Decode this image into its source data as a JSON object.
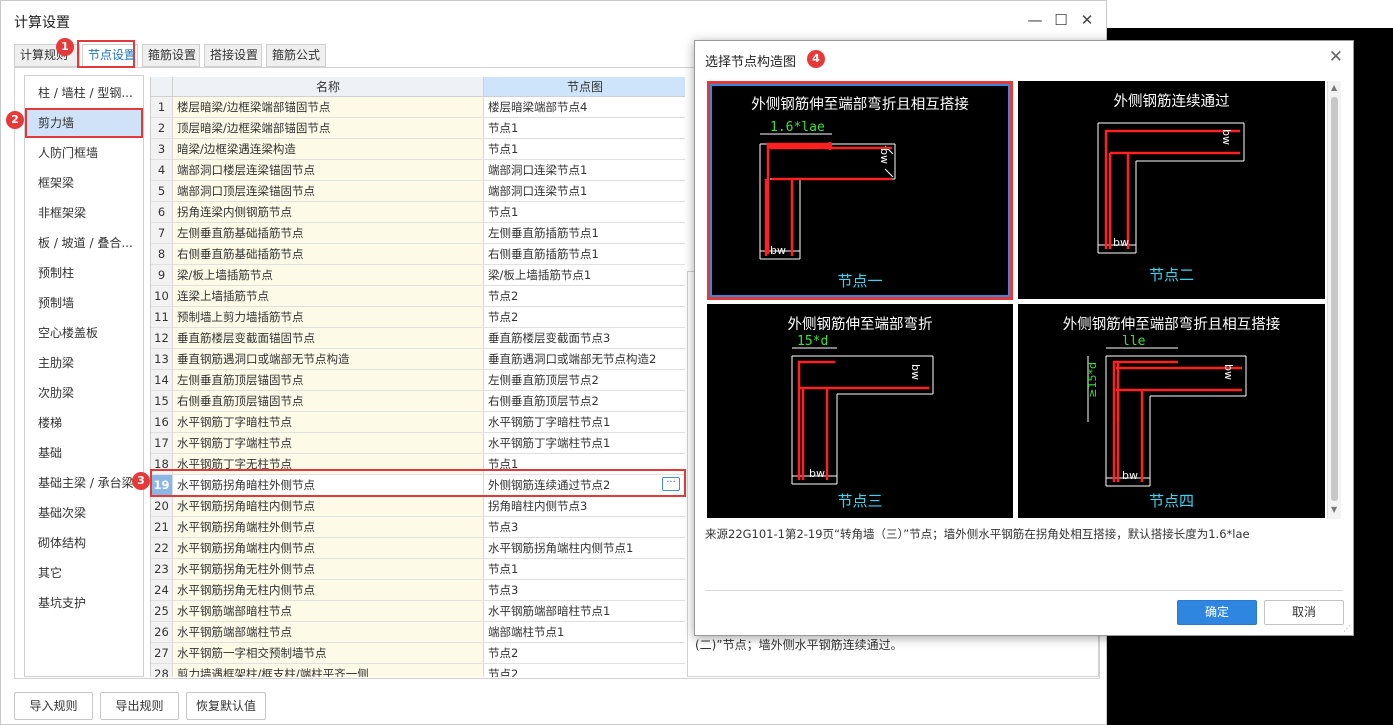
{
  "window": {
    "title": "计算设置",
    "minimize": "—",
    "maximize": "☐",
    "close": "✕"
  },
  "tabs": [
    {
      "label": "计算规则"
    },
    {
      "label": "节点设置"
    },
    {
      "label": "箍筋设置"
    },
    {
      "label": "搭接设置"
    },
    {
      "label": "箍筋公式"
    }
  ],
  "sidebar": {
    "items": [
      {
        "label": "柱 / 墙柱 / 型钢..."
      },
      {
        "label": "剪力墙"
      },
      {
        "label": "人防门框墙"
      },
      {
        "label": "框架梁"
      },
      {
        "label": "非框架梁"
      },
      {
        "label": "板 / 坡道 / 叠合..."
      },
      {
        "label": "预制柱"
      },
      {
        "label": "预制墙"
      },
      {
        "label": "空心楼盖板"
      },
      {
        "label": "主肋梁"
      },
      {
        "label": "次肋梁"
      },
      {
        "label": "楼梯"
      },
      {
        "label": "基础"
      },
      {
        "label": "基础主梁 / 承台梁"
      },
      {
        "label": "基础次梁"
      },
      {
        "label": "砌体结构"
      },
      {
        "label": "其它"
      },
      {
        "label": "基坑支护"
      }
    ]
  },
  "grid": {
    "columns": {
      "name": "名称",
      "node": "节点图"
    },
    "rows": [
      {
        "idx": "1",
        "name": "楼层暗梁/边框梁端部锚固节点",
        "node": "楼层暗梁端部节点4"
      },
      {
        "idx": "2",
        "name": "顶层暗梁/边框梁端部锚固节点",
        "node": "节点1"
      },
      {
        "idx": "3",
        "name": "暗梁/边框梁遇连梁构造",
        "node": "节点1"
      },
      {
        "idx": "4",
        "name": "端部洞口楼层连梁锚固节点",
        "node": "端部洞口连梁节点1"
      },
      {
        "idx": "5",
        "name": "端部洞口顶层连梁锚固节点",
        "node": "端部洞口连梁节点1"
      },
      {
        "idx": "6",
        "name": "拐角连梁内侧钢筋节点",
        "node": "节点1"
      },
      {
        "idx": "7",
        "name": "左侧垂直筋基础插筋节点",
        "node": "左侧垂直筋插筋节点1"
      },
      {
        "idx": "8",
        "name": "右侧垂直筋基础插筋节点",
        "node": "右侧垂直筋插筋节点1"
      },
      {
        "idx": "9",
        "name": "梁/板上墙插筋节点",
        "node": "梁/板上墙插筋节点1"
      },
      {
        "idx": "10",
        "name": "连梁上墙插筋节点",
        "node": "节点2"
      },
      {
        "idx": "11",
        "name": "预制墙上剪力墙插筋节点",
        "node": "节点2"
      },
      {
        "idx": "12",
        "name": "垂直筋楼层变截面锚固节点",
        "node": "垂直筋楼层变截面节点3"
      },
      {
        "idx": "13",
        "name": "垂直钢筋遇洞口或端部无节点构造",
        "node": "垂直筋遇洞口或端部无节点构造2"
      },
      {
        "idx": "14",
        "name": "左侧垂直筋顶层锚固节点",
        "node": "左侧垂直筋顶层节点2"
      },
      {
        "idx": "15",
        "name": "右侧垂直筋顶层锚固节点",
        "node": "右侧垂直筋顶层节点2"
      },
      {
        "idx": "16",
        "name": "水平钢筋丁字暗柱节点",
        "node": "水平钢筋丁字暗柱节点1"
      },
      {
        "idx": "17",
        "name": "水平钢筋丁字端柱节点",
        "node": "水平钢筋丁字端柱节点1"
      },
      {
        "idx": "18",
        "name": "水平钢筋丁字无柱节点",
        "node": "节点1"
      },
      {
        "idx": "19",
        "name": "水平钢筋拐角暗柱外侧节点",
        "node": "外侧钢筋连续通过节点2"
      },
      {
        "idx": "20",
        "name": "水平钢筋拐角暗柱内侧节点",
        "node": "拐角暗柱内侧节点3"
      },
      {
        "idx": "21",
        "name": "水平钢筋拐角端柱外侧节点",
        "node": "节点3"
      },
      {
        "idx": "22",
        "name": "水平钢筋拐角端柱内侧节点",
        "node": "水平钢筋拐角端柱内侧节点1"
      },
      {
        "idx": "23",
        "name": "水平钢筋拐角无柱外侧节点",
        "node": "节点1"
      },
      {
        "idx": "24",
        "name": "水平钢筋拐角无柱内侧节点",
        "node": "节点3"
      },
      {
        "idx": "25",
        "name": "水平钢筋端部暗柱节点",
        "node": "水平钢筋端部暗柱节点1"
      },
      {
        "idx": "26",
        "name": "水平钢筋端部端柱节点",
        "node": "端部端柱节点1"
      },
      {
        "idx": "27",
        "name": "水平钢筋一字相交预制墙节点",
        "node": "节点2"
      },
      {
        "idx": "28",
        "name": "剪力墙遇框架柱/框支柱/端柱平齐一侧",
        "node": "节点2"
      }
    ],
    "ellipsis": "···"
  },
  "desc_panel": {
    "text": "(二)”节点；墙外侧水平钢筋连续通过。"
  },
  "bottom_buttons": {
    "import": "导入规则",
    "export": "导出规则",
    "restore": "恢复默认值"
  },
  "dialog": {
    "title": "选择节点构造图",
    "close": "✕",
    "nodes": [
      {
        "title": "外侧钢筋伸至端部弯折且相互搭接",
        "label": "节点一",
        "dim_top": "1.6*lae",
        "dim_side": "bw",
        "dim_bottom": "bw"
      },
      {
        "title": "外侧钢筋连续通过",
        "label": "节点二",
        "dim_side": "bw",
        "dim_bottom": "bw"
      },
      {
        "title": "外侧钢筋伸至端部弯折",
        "label": "节点三",
        "dim_top": "15*d",
        "dim_side": "bw",
        "dim_bottom": "bw"
      },
      {
        "title": "外侧钢筋伸至端部弯折且相互搭接",
        "label": "节点四",
        "dim_top": "lle",
        "dim_left": "≥15*d",
        "dim_side": "bw",
        "dim_bottom": "bw"
      }
    ],
    "description": "来源22G101-1第2-19页“转角墙（三）”节点；墙外侧水平钢筋在拐角处相互搭接，默认搭接长度为1.6*lae",
    "ok": "确定",
    "cancel": "取消"
  },
  "callouts": [
    "1",
    "2",
    "3",
    "4"
  ],
  "colors": {
    "accent": "#2f86e0",
    "highlight": "#e23a3a",
    "rebar": "#ff2020",
    "node_label": "#35d7f2",
    "dim_text": "#38e038"
  }
}
